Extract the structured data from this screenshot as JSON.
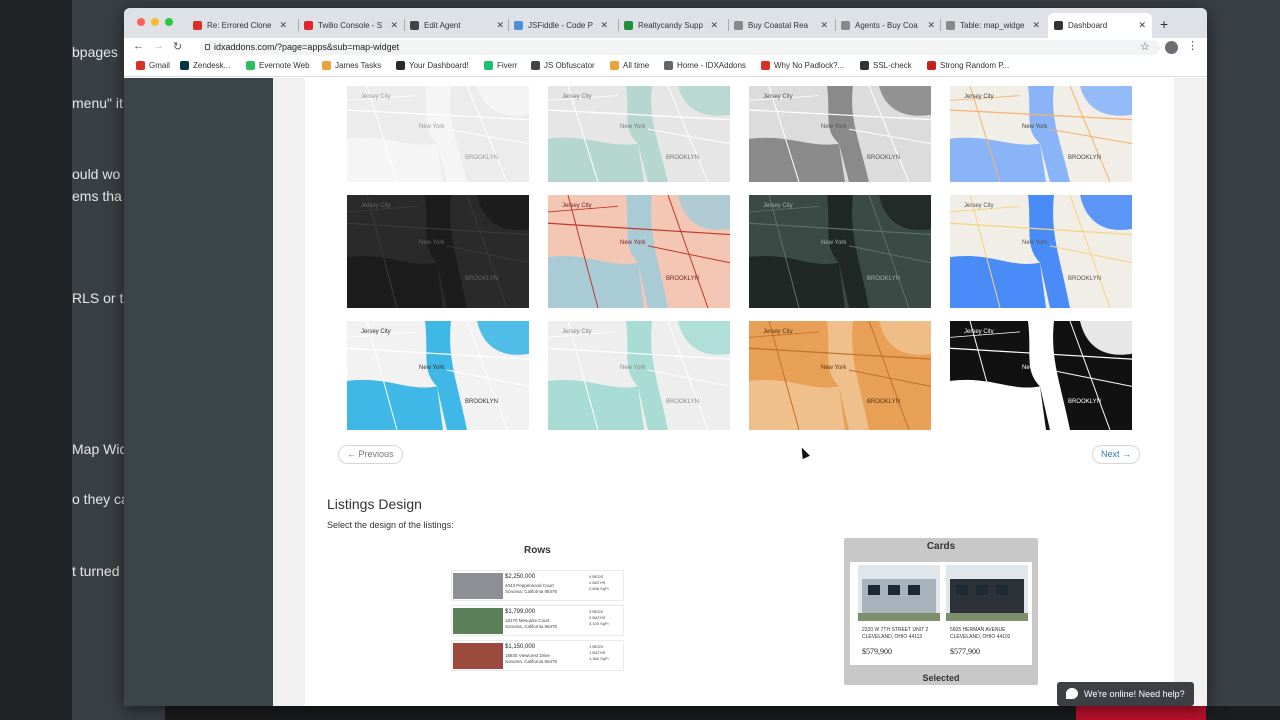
{
  "background_app": {
    "lines": [
      "bpages",
      "menu\" it",
      "ould wo",
      "ems tha",
      "RLS or th",
      "Map Wid",
      "o they ca",
      "t turned"
    ]
  },
  "browser": {
    "tabs": [
      {
        "title": "Re: Errored Clone",
        "fav_color": "#d93025"
      },
      {
        "title": "Twilio Console - S",
        "fav_color": "#e1242f"
      },
      {
        "title": "Edit Agent",
        "fav_color": "#444444"
      },
      {
        "title": "JSFiddle - Code P",
        "fav_color": "#4a90d9"
      },
      {
        "title": "Realtycandy Supp",
        "fav_color": "#1e8e3e"
      },
      {
        "title": "Buy Coastal Rea",
        "fav_color": "#888888"
      },
      {
        "title": "Agents - Buy Coa",
        "fav_color": "#888888"
      },
      {
        "title": "Table: map_widge",
        "fav_color": "#888888"
      },
      {
        "title": "Dashboard",
        "fav_color": "#333333"
      }
    ],
    "active_tab": 8,
    "url": "idxaddons.com/?page=apps&sub=map-widget",
    "bookmarks": [
      {
        "label": "Gmail",
        "color": "#d93025"
      },
      {
        "label": "Zendesk...",
        "color": "#03363d"
      },
      {
        "label": "Evernote Web",
        "color": "#2dbe60"
      },
      {
        "label": "James Tasks",
        "color": "#e8a33d"
      },
      {
        "label": "Your Dashboard!",
        "color": "#2b2b2b"
      },
      {
        "label": "Fiverr",
        "color": "#1dbf73"
      },
      {
        "label": "JS Obfuscator",
        "color": "#444444"
      },
      {
        "label": "All time",
        "color": "#e8a33d"
      },
      {
        "label": "Home - IDXAddons",
        "color": "#666666"
      },
      {
        "label": "Why No Padlock?...",
        "color": "#d93025"
      },
      {
        "label": "SSL-check",
        "color": "#333333"
      },
      {
        "label": "Strong Random P...",
        "color": "#c5221f"
      }
    ]
  },
  "map_styles": {
    "rows": [
      [
        {
          "style": "light-grey",
          "land": "#ececec",
          "water": "#f5f5f5",
          "road": "#ffffff",
          "label": "#999999"
        },
        {
          "style": "grey-teal",
          "land": "#e6e6e6",
          "water": "#b5d7cf",
          "road": "#ffffff",
          "label": "#777777"
        },
        {
          "style": "grayscale",
          "land": "#dcdcdc",
          "water": "#8a8a8a",
          "road": "#ffffff",
          "label": "#555555"
        },
        {
          "style": "classic",
          "land": "#f0eee6",
          "water": "#8ab4f8",
          "road": "#f6b26b",
          "label": "#444444"
        }
      ],
      [
        {
          "style": "dark",
          "land": "#2a2a2a",
          "water": "#1c1c1c",
          "road": "#3a3a3a",
          "label": "#666666"
        },
        {
          "style": "red-roads",
          "land": "#f4c7b5",
          "water": "#a9cbd6",
          "road": "#c0392b",
          "label": "#7a2222"
        },
        {
          "style": "dark-green",
          "land": "#3a4a44",
          "water": "#202826",
          "road": "#5d7068",
          "label": "#9fb3aa"
        },
        {
          "style": "google-default",
          "land": "#f0eee6",
          "water": "#4a8cf7",
          "road": "#f9d27c",
          "label": "#555555"
        }
      ],
      [
        {
          "style": "bright-blue",
          "land": "#f2f2f2",
          "water": "#3fb8e8",
          "road": "#ffffff",
          "label": "#333333"
        },
        {
          "style": "mint",
          "land": "#eeeeee",
          "water": "#a8dcd5",
          "road": "#ffffff",
          "label": "#888888"
        },
        {
          "style": "orange",
          "land": "#e7a055",
          "water": "#f0c08c",
          "road": "#c0702a",
          "label": "#5a3010"
        },
        {
          "style": "black-white",
          "land": "#111111",
          "water": "#ffffff",
          "road": "#ffffff",
          "label": "#ffffff"
        }
      ]
    ],
    "labels": {
      "city1": "Jersey City",
      "city2": "New York",
      "borough": "BROOKLYN"
    }
  },
  "pagination": {
    "prev": "← Previous",
    "next": "Next →"
  },
  "listings_design": {
    "heading": "Listings Design",
    "description": "Select the design of the listings:",
    "rows_option": {
      "title": "Rows",
      "items": [
        {
          "price": "$2,250,000",
          "addr1": "4043 Pepperwood Court",
          "addr2": "Sonoma, California 95476",
          "beds": "4 BEDS",
          "baths": "4 BATHS",
          "sqft": "2,808 SqFt",
          "color": "#8d8f94"
        },
        {
          "price": "$1,799,000",
          "addr1": "18170 Mesquite Court",
          "addr2": "Sonoma, California 95476",
          "beds": "3 BEDS",
          "baths": "3 BATHS",
          "sqft": "3,100 SqFt",
          "color": "#5b7f59"
        },
        {
          "price": "$1,150,000",
          "addr1": "18845 Viewcrest Drive",
          "addr2": "Sonoma, California 95476",
          "beds": "1 BEDS",
          "baths": "1 BATHS",
          "sqft": "1,366 SqFt",
          "color": "#9b4a3d"
        }
      ]
    },
    "cards_option": {
      "title": "Cards",
      "selected_label": "Selected",
      "items": [
        {
          "addr1": "2220 W 7TH STREET UNIT 2",
          "addr2": "CLEVELAND, OHIO 44113",
          "price": "$579,900",
          "color": "#a9b3bd"
        },
        {
          "addr1": "5605 HERMAN AVENUE",
          "addr2": "CLEVELAND, OHIO 44102",
          "price": "$577,900",
          "color": "#2d3238"
        }
      ]
    }
  },
  "chat": {
    "label": "We're online! Need help?"
  }
}
